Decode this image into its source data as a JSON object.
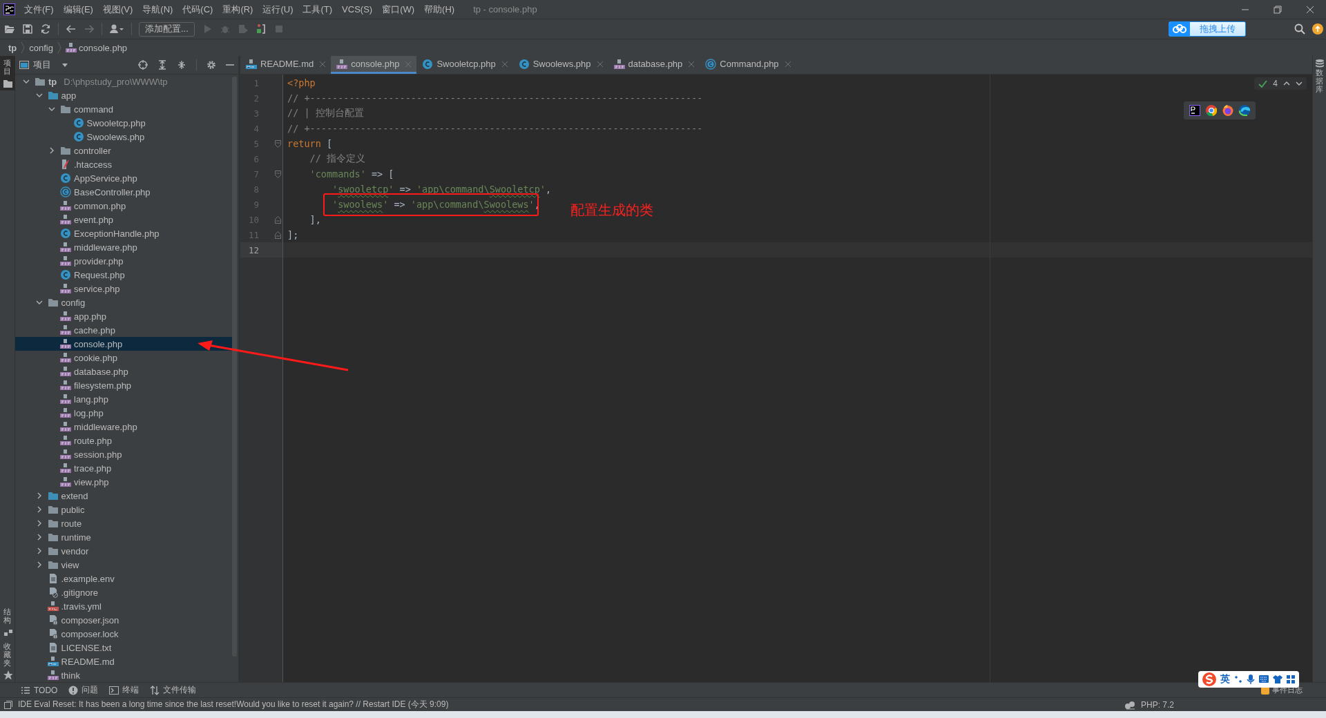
{
  "window": {
    "title": "tp - console.php"
  },
  "menu": [
    "文件(F)",
    "编辑(E)",
    "视图(V)",
    "导航(N)",
    "代码(C)",
    "重构(R)",
    "运行(U)",
    "工具(T)",
    "VCS(S)",
    "窗口(W)",
    "帮助(H)"
  ],
  "toolbar": {
    "run_config": "添加配置...",
    "upload_button": "拖拽上传"
  },
  "breadcrumb": [
    {
      "label": "tp",
      "kind": "project"
    },
    {
      "label": "config",
      "kind": "folder"
    },
    {
      "label": "console.php",
      "kind": "php"
    }
  ],
  "left_strip": [
    {
      "label": "项目",
      "selected": true
    },
    {
      "label": "结构",
      "selected": false
    },
    {
      "label": "收藏夹",
      "selected": false
    }
  ],
  "right_strip": [
    {
      "label": "数据库"
    }
  ],
  "project": {
    "title": "项目",
    "tree": [
      {
        "label": "tp",
        "path": "D:\\phpstudy_pro\\WWW\\tp",
        "kind": "folder",
        "expanded": true,
        "selected": false,
        "children": [
          {
            "label": "app",
            "kind": "source",
            "expanded": true,
            "selected": false,
            "children": [
              {
                "label": "command",
                "kind": "folder",
                "expanded": true,
                "selected": false,
                "children": [
                  {
                    "label": "Swooletcp.php",
                    "kind": "class",
                    "selected": false
                  },
                  {
                    "label": "Swoolews.php",
                    "kind": "class",
                    "selected": false
                  }
                ]
              },
              {
                "label": "controller",
                "kind": "folder",
                "expanded": false,
                "selected": false
              },
              {
                "label": ".htaccess",
                "kind": "htaccess",
                "selected": false
              },
              {
                "label": "AppService.php",
                "kind": "class",
                "selected": false
              },
              {
                "label": "BaseController.php",
                "kind": "abstract",
                "selected": false
              },
              {
                "label": "common.php",
                "kind": "php",
                "selected": false
              },
              {
                "label": "event.php",
                "kind": "php",
                "selected": false
              },
              {
                "label": "ExceptionHandle.php",
                "kind": "class",
                "selected": false
              },
              {
                "label": "middleware.php",
                "kind": "php",
                "selected": false
              },
              {
                "label": "provider.php",
                "kind": "php",
                "selected": false
              },
              {
                "label": "Request.php",
                "kind": "class",
                "selected": false
              },
              {
                "label": "service.php",
                "kind": "php",
                "selected": false
              }
            ]
          },
          {
            "label": "config",
            "kind": "folder",
            "expanded": true,
            "selected": false,
            "children": [
              {
                "label": "app.php",
                "kind": "php",
                "selected": false
              },
              {
                "label": "cache.php",
                "kind": "php",
                "selected": false
              },
              {
                "label": "console.php",
                "kind": "php",
                "selected": true
              },
              {
                "label": "cookie.php",
                "kind": "php",
                "selected": false
              },
              {
                "label": "database.php",
                "kind": "php",
                "selected": false
              },
              {
                "label": "filesystem.php",
                "kind": "php",
                "selected": false
              },
              {
                "label": "lang.php",
                "kind": "php",
                "selected": false
              },
              {
                "label": "log.php",
                "kind": "php",
                "selected": false
              },
              {
                "label": "middleware.php",
                "kind": "php",
                "selected": false
              },
              {
                "label": "route.php",
                "kind": "php",
                "selected": false
              },
              {
                "label": "session.php",
                "kind": "php",
                "selected": false
              },
              {
                "label": "trace.php",
                "kind": "php",
                "selected": false
              },
              {
                "label": "view.php",
                "kind": "php",
                "selected": false
              }
            ]
          },
          {
            "label": "extend",
            "kind": "source",
            "expanded": false,
            "selected": false
          },
          {
            "label": "public",
            "kind": "folder",
            "expanded": false,
            "selected": false
          },
          {
            "label": "route",
            "kind": "folder",
            "expanded": false,
            "selected": false
          },
          {
            "label": "runtime",
            "kind": "folder",
            "expanded": false,
            "selected": false
          },
          {
            "label": "vendor",
            "kind": "folder",
            "expanded": false,
            "selected": false
          },
          {
            "label": "view",
            "kind": "folder",
            "expanded": false,
            "selected": false
          },
          {
            "label": ".example.env",
            "kind": "text",
            "selected": false
          },
          {
            "label": ".gitignore",
            "kind": "ignore",
            "selected": false
          },
          {
            "label": ".travis.yml",
            "kind": "yml",
            "selected": false
          },
          {
            "label": "composer.json",
            "kind": "json",
            "selected": false
          },
          {
            "label": "composer.lock",
            "kind": "json",
            "selected": false
          },
          {
            "label": "LICENSE.txt",
            "kind": "text",
            "selected": false
          },
          {
            "label": "README.md",
            "kind": "md",
            "selected": false
          },
          {
            "label": "think",
            "kind": "php",
            "selected": false
          }
        ]
      }
    ]
  },
  "tabs": [
    {
      "label": "README.md",
      "kind": "md",
      "selected": false
    },
    {
      "label": "console.php",
      "kind": "php",
      "selected": true
    },
    {
      "label": "Swooletcp.php",
      "kind": "class",
      "selected": false
    },
    {
      "label": "Swoolews.php",
      "kind": "class",
      "selected": false
    },
    {
      "label": "database.php",
      "kind": "php",
      "selected": false
    },
    {
      "label": "Command.php",
      "kind": "abstract",
      "selected": false
    }
  ],
  "editor": {
    "inspections": "4",
    "lines": [
      {
        "number": "1",
        "kind": "plain",
        "current": false,
        "tokens": [
          {
            "kind": "keyword",
            "text": "<?php"
          }
        ]
      },
      {
        "number": "2",
        "kind": "plain",
        "current": false,
        "tokens": [
          {
            "kind": "comment",
            "text": "// +----------------------------------------------------------------------"
          }
        ]
      },
      {
        "number": "3",
        "kind": "plain",
        "current": false,
        "tokens": [
          {
            "kind": "comment",
            "text": "// | 控制台配置"
          }
        ]
      },
      {
        "number": "4",
        "kind": "plain",
        "current": false,
        "tokens": [
          {
            "kind": "comment",
            "text": "// +----------------------------------------------------------------------"
          }
        ]
      },
      {
        "number": "5",
        "kind": "opener",
        "current": false,
        "tokens": [
          {
            "kind": "keyword",
            "text": "return"
          },
          {
            "kind": "plain",
            "text": " ["
          }
        ]
      },
      {
        "number": "6",
        "kind": "plain",
        "current": false,
        "tokens": [
          {
            "kind": "comment",
            "text": "    // 指令定义"
          }
        ]
      },
      {
        "number": "7",
        "kind": "opener",
        "current": false,
        "tokens": [
          {
            "kind": "string",
            "text": "    'commands'"
          },
          {
            "kind": "plain",
            "text": " => ["
          }
        ]
      },
      {
        "number": "8",
        "kind": "plain",
        "current": false,
        "tokens": [
          {
            "kind": "string",
            "text": "        '"
          },
          {
            "kind": "typo",
            "text": "swooletcp"
          },
          {
            "kind": "string",
            "text": "'"
          },
          {
            "kind": "plain",
            "text": " => "
          },
          {
            "kind": "string",
            "text": "'app\\command\\"
          },
          {
            "kind": "typo",
            "text": "Swooletcp"
          },
          {
            "kind": "string",
            "text": "'"
          },
          {
            "kind": "plain",
            "text": ","
          }
        ]
      },
      {
        "number": "9",
        "kind": "plain",
        "current": false,
        "tokens": [
          {
            "kind": "string",
            "text": "        '"
          },
          {
            "kind": "typo",
            "text": "swoolews"
          },
          {
            "kind": "string",
            "text": "'"
          },
          {
            "kind": "plain",
            "text": " => "
          },
          {
            "kind": "string",
            "text": "'app\\command\\"
          },
          {
            "kind": "typo",
            "text": "Swoolews"
          },
          {
            "kind": "string",
            "text": "'"
          },
          {
            "kind": "plain",
            "text": ","
          }
        ]
      },
      {
        "number": "10",
        "kind": "closer",
        "current": false,
        "tokens": [
          {
            "kind": "plain",
            "text": "    ],"
          }
        ]
      },
      {
        "number": "11",
        "kind": "closer",
        "current": false,
        "tokens": [
          {
            "kind": "plain",
            "text": "];"
          }
        ]
      },
      {
        "number": "12",
        "kind": "plain",
        "current": true
      }
    ]
  },
  "annotation": {
    "note": "配置生成的类"
  },
  "bottom_tools": [
    {
      "label": "TODO",
      "kind": "list"
    },
    {
      "label": "问题",
      "kind": "info"
    },
    {
      "label": "终端",
      "kind": "terminal"
    },
    {
      "label": "文件传输",
      "kind": "transfer"
    }
  ],
  "ime": {
    "mode": "英"
  },
  "event_log": "事件日志",
  "status": {
    "message": "IDE Eval Reset: It has been a long time since the last reset!Would you like to reset it again? // Restart IDE (今天 9:09)",
    "php": "PHP: 7.2"
  }
}
